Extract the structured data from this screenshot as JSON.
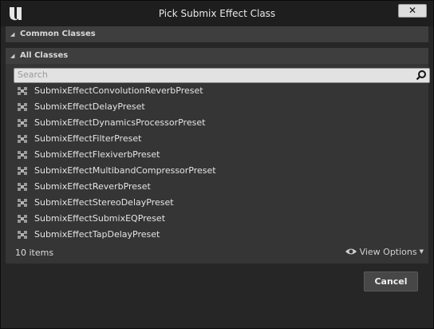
{
  "window": {
    "title": "Pick Submix Effect Class",
    "close_label": "✕"
  },
  "sections": {
    "common": {
      "label": "Common Classes",
      "collapsed": true
    },
    "all": {
      "label": "All Classes",
      "collapsed": false
    }
  },
  "search": {
    "placeholder": "Search",
    "value": ""
  },
  "items": [
    "SubmixEffectConvolutionReverbPreset",
    "SubmixEffectDelayPreset",
    "SubmixEffectDynamicsProcessorPreset",
    "SubmixEffectFilterPreset",
    "SubmixEffectFlexiverbPreset",
    "SubmixEffectMultibandCompressorPreset",
    "SubmixEffectReverbPreset",
    "SubmixEffectStereoDelayPreset",
    "SubmixEffectSubmixEQPreset",
    "SubmixEffectTapDelayPreset"
  ],
  "footer": {
    "count": "10 items",
    "view_options": "View Options"
  },
  "buttons": {
    "cancel": "Cancel"
  },
  "icons": {
    "logo": "unreal-engine-logo",
    "section_arrow": "triangle-icon",
    "search": "search-icon",
    "class": "class-icon",
    "view": "eye-icon"
  }
}
